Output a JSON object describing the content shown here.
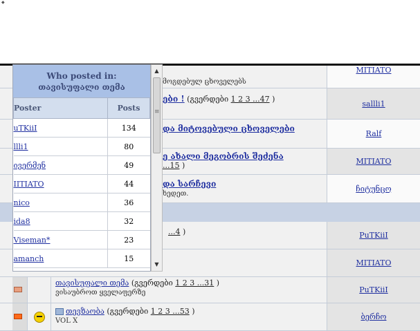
{
  "popup": {
    "title": "Who posted in: თავისუფალი თემა",
    "col_poster": "Poster",
    "col_posts": "Posts",
    "rows": [
      {
        "name": "uTKiiI",
        "count": "134"
      },
      {
        "name": "llli1",
        "count": "80"
      },
      {
        "name": "ივერმენ",
        "count": "49"
      },
      {
        "name": "IIТIATO",
        "count": "44"
      },
      {
        "name": "nico",
        "count": "36"
      },
      {
        "name": "ida8",
        "count": "32"
      },
      {
        "name": "Viseman*",
        "count": "23"
      },
      {
        "name": "amanch",
        "count": "15"
      }
    ]
  },
  "forum": {
    "rows": [
      {
        "title": "",
        "pages_prefix": "",
        "pages_links": "",
        "pages_suffix": "",
        "desc": "მოგდებულ ცხოველებს",
        "user": "MITIATO"
      },
      {
        "title": "ები !",
        "pages_prefix": " (გვერდები ",
        "pages_links": "1 2 3 ...47",
        "pages_suffix": " )",
        "desc": "",
        "user": "sallli1"
      },
      {
        "title": "და მიტოვებული ცხოველები",
        "pages_prefix": "",
        "pages_links": "",
        "pages_suffix": "",
        "desc": "",
        "user": "Ralf"
      },
      {
        "title": "ე ახალი მეგობრის შეძენა",
        "pages_prefix": "",
        "pages_links": "...15",
        "pages_suffix": " )",
        "desc": "",
        "user": "MITIATO"
      },
      {
        "title": "და სარჩევი",
        "pages_prefix": "",
        "pages_links": "",
        "pages_suffix": "",
        "desc": "ხედეთ.",
        "user": "ჩიტუნცო"
      }
    ],
    "rows2": [
      {
        "links": "...4",
        "suffix": " )",
        "user": "PuTKiiI"
      },
      {
        "links": "",
        "suffix": "",
        "user": "MITIATO"
      }
    ],
    "lower_rows": [
      {
        "title": "თავისუფალი თემა",
        "pages_prefix": " (გვერდები ",
        "pages_links": "1 2 3 ...31",
        "pages_suffix": " )",
        "desc": "ვისაუბროთ ყველაფერზე",
        "user": "PuTKiiI"
      },
      {
        "title": "თევზაობა",
        "pages_prefix": " (გვერდები ",
        "pages_links": "1 2 3 ...53",
        "pages_suffix": " )",
        "desc": "VOL X",
        "user": "ბერჩო"
      }
    ]
  }
}
